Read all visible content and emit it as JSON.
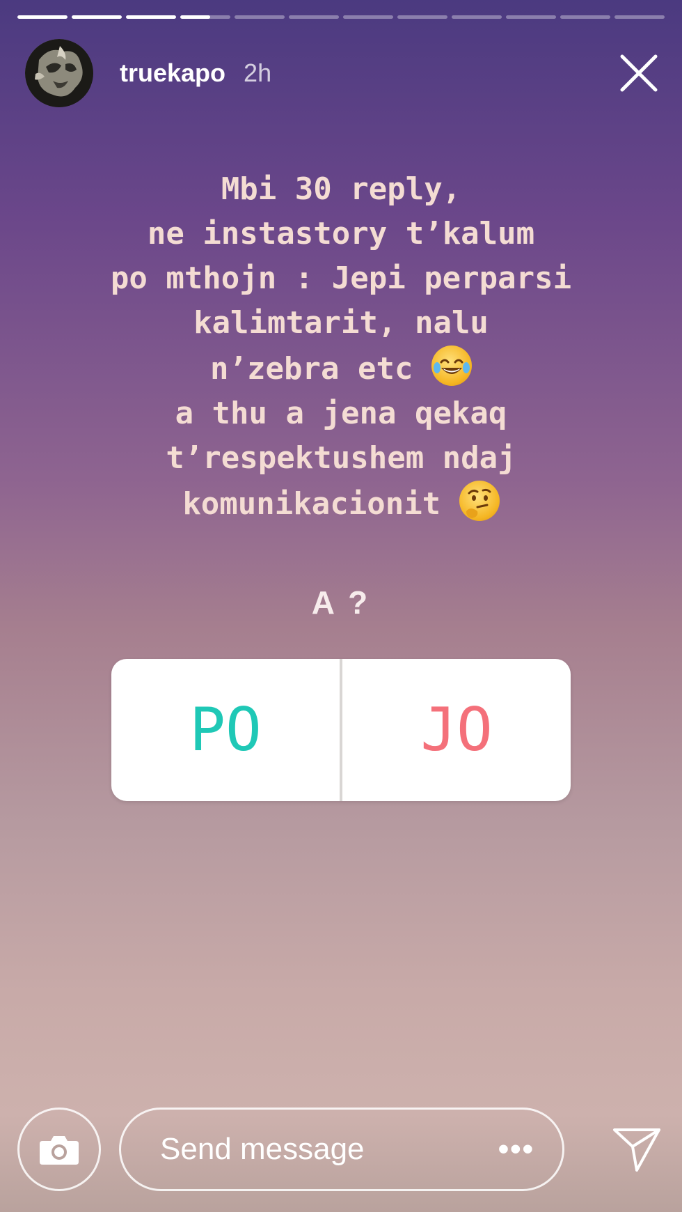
{
  "progress": {
    "segments": [
      1,
      1,
      1,
      0.6,
      0,
      0,
      0,
      0,
      0,
      0,
      0,
      0
    ]
  },
  "header": {
    "username": "truekapo",
    "time_ago": "2h",
    "avatar_icon": "avatar-photo",
    "close_icon": "close-icon"
  },
  "story": {
    "lines": [
      "Mbi 30 reply,",
      "ne instastory t’kalum",
      "po mthojn : Jepi perparsi",
      "kalimtarit, nalu",
      "n’zebra etc",
      "a thu a jena qekaq",
      "t’respektushem ndaj",
      "komunikacionit"
    ],
    "emoji_1": "laughing-tears-emoji",
    "emoji_2": "thinking-face-emoji"
  },
  "poll": {
    "question": "A ?",
    "option_yes": "PO",
    "option_no": "JO",
    "colors": {
      "yes": "#1fc8b6",
      "no": "#f4707a"
    }
  },
  "bottom_bar": {
    "placeholder": "Send message",
    "more_label": "•••",
    "camera_icon": "camera-icon",
    "send_icon": "send-icon"
  }
}
